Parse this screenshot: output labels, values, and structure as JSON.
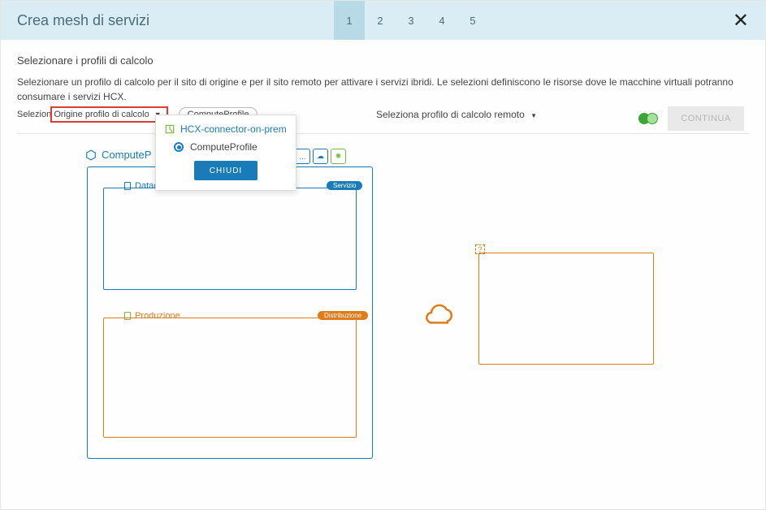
{
  "header": {
    "title": "Crea mesh di servizi",
    "steps": [
      "1",
      "2",
      "3",
      "4",
      "5"
    ],
    "close_icon": "close"
  },
  "page": {
    "subtitle": "Selezionare i profili di calcolo",
    "description": "Selezionare un profilo di calcolo per il sito di origine e per il sito remoto per attivare i servizi ibridi. Le selezioni definiscono le risorse dove le macchine virtuali potranno consumare i servizi HCX.",
    "origin_prefix": "Selezione",
    "origin_dropdown_label": "Origine profilo di calcolo",
    "chip_label": "ComputeProfile",
    "remote_label": "Seleziona profilo di calcolo remoto",
    "continue_label": "CONTINUA"
  },
  "diagram": {
    "compute_profile_label": "ComputeP",
    "datacenter_label": "Datac",
    "service_badge": "Servizio",
    "production_label": "Produzione",
    "distribution_badge": "Distribuzione",
    "remote_marker": "?"
  },
  "popover": {
    "header": "HCX-connector-on-prem",
    "item": "ComputeProfile",
    "close_label": "CHIUDI"
  }
}
